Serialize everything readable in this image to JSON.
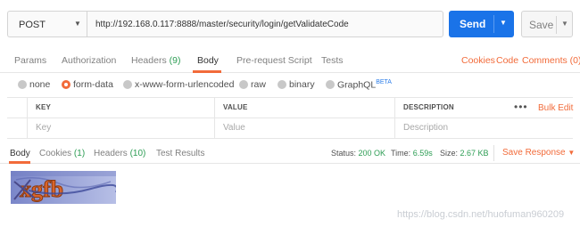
{
  "request": {
    "method": "POST",
    "url": "http://192.168.0.117:8888/master/security/login/getValidateCode",
    "send_label": "Send",
    "save_label": "Save"
  },
  "request_tabs": {
    "params": "Params",
    "authorization": "Authorization",
    "headers": "Headers",
    "headers_count": "(9)",
    "body": "Body",
    "prerequest": "Pre-request Script",
    "tests": "Tests",
    "cookies": "Cookies",
    "code": "Code",
    "comments": "Comments (0)"
  },
  "body_modes": {
    "none": "none",
    "form_data": "form-data",
    "urlencoded": "x-www-form-urlencoded",
    "raw": "raw",
    "binary": "binary",
    "graphql": "GraphQL",
    "beta": "BETA",
    "selected": "form-data"
  },
  "kv_table": {
    "headers": [
      "KEY",
      "VALUE",
      "DESCRIPTION"
    ],
    "placeholders": [
      "Key",
      "Value",
      "Description"
    ],
    "bulk_edit": "Bulk Edit",
    "more": "•••"
  },
  "response_tabs": {
    "body": "Body",
    "cookies": "Cookies",
    "cookies_count": "(1)",
    "headers": "Headers",
    "headers_count": "(10)",
    "test_results": "Test Results",
    "status_label": "Status:",
    "status_value": "200 OK",
    "time_label": "Time:",
    "time_value": "6.59s",
    "size_label": "Size:",
    "size_value": "2.67 KB",
    "save_response": "Save Response"
  },
  "captcha_text": "xgfb",
  "watermark": "https://blog.csdn.net/huofuman960209",
  "colors": {
    "accent": "#f26b3a",
    "send_blue": "#1a73e8",
    "ok_green": "#2d9d54"
  }
}
